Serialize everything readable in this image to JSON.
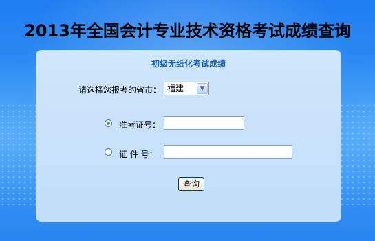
{
  "header": {
    "title": "2013年全国会计专业技术资格考试成绩查询"
  },
  "panel": {
    "title": "初级无纸化考试成绩",
    "province": {
      "label": "请选择您报考的省市：",
      "selected": "福建"
    },
    "exam_id": {
      "label": "准考证号：",
      "selected": true,
      "value": ""
    },
    "id_number": {
      "label": "证 件 号：",
      "selected": false,
      "value": ""
    },
    "query_button": "查询"
  },
  "colors": {
    "panel_title": "#1a5fb4",
    "radio_checked": "#2fa82f",
    "background": "#2f8ff4"
  }
}
